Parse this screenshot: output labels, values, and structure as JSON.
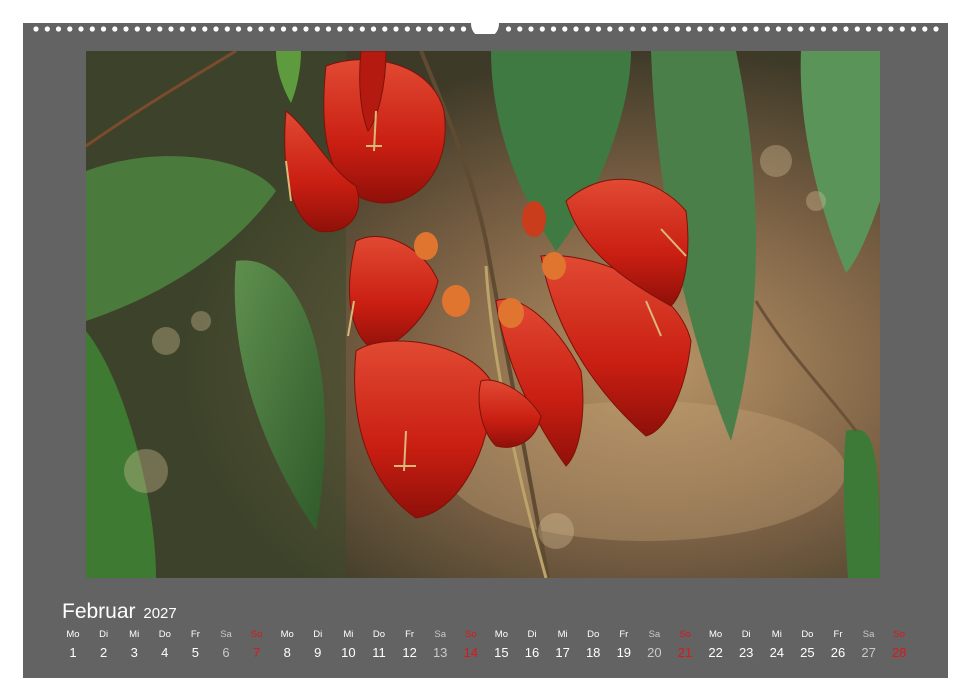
{
  "calendar": {
    "month": "Februar",
    "year": "2027",
    "days": [
      {
        "name": "Mo",
        "num": "1",
        "kind": "weekday"
      },
      {
        "name": "Di",
        "num": "2",
        "kind": "weekday"
      },
      {
        "name": "Mi",
        "num": "3",
        "kind": "weekday"
      },
      {
        "name": "Do",
        "num": "4",
        "kind": "weekday"
      },
      {
        "name": "Fr",
        "num": "5",
        "kind": "weekday"
      },
      {
        "name": "Sa",
        "num": "6",
        "kind": "saturday"
      },
      {
        "name": "So",
        "num": "7",
        "kind": "sunday"
      },
      {
        "name": "Mo",
        "num": "8",
        "kind": "weekday"
      },
      {
        "name": "Di",
        "num": "9",
        "kind": "weekday"
      },
      {
        "name": "Mi",
        "num": "10",
        "kind": "weekday"
      },
      {
        "name": "Do",
        "num": "11",
        "kind": "weekday"
      },
      {
        "name": "Fr",
        "num": "12",
        "kind": "weekday"
      },
      {
        "name": "Sa",
        "num": "13",
        "kind": "saturday"
      },
      {
        "name": "So",
        "num": "14",
        "kind": "sunday"
      },
      {
        "name": "Mo",
        "num": "15",
        "kind": "weekday"
      },
      {
        "name": "Di",
        "num": "16",
        "kind": "weekday"
      },
      {
        "name": "Mi",
        "num": "17",
        "kind": "weekday"
      },
      {
        "name": "Do",
        "num": "18",
        "kind": "weekday"
      },
      {
        "name": "Fr",
        "num": "19",
        "kind": "weekday"
      },
      {
        "name": "Sa",
        "num": "20",
        "kind": "saturday"
      },
      {
        "name": "So",
        "num": "21",
        "kind": "sunday"
      },
      {
        "name": "Mo",
        "num": "22",
        "kind": "weekday"
      },
      {
        "name": "Di",
        "num": "23",
        "kind": "weekday"
      },
      {
        "name": "Mi",
        "num": "24",
        "kind": "weekday"
      },
      {
        "name": "Do",
        "num": "25",
        "kind": "weekday"
      },
      {
        "name": "Fr",
        "num": "26",
        "kind": "weekday"
      },
      {
        "name": "Sa",
        "num": "27",
        "kind": "saturday"
      },
      {
        "name": "So",
        "num": "28",
        "kind": "sunday"
      }
    ]
  },
  "colors": {
    "page_background": "#636363",
    "weekday_text": "#ffffff",
    "saturday_text": "#c9c9c9",
    "sunday_text": "#e0151a"
  },
  "photo": {
    "subject_icon": "red-flower-photo"
  }
}
